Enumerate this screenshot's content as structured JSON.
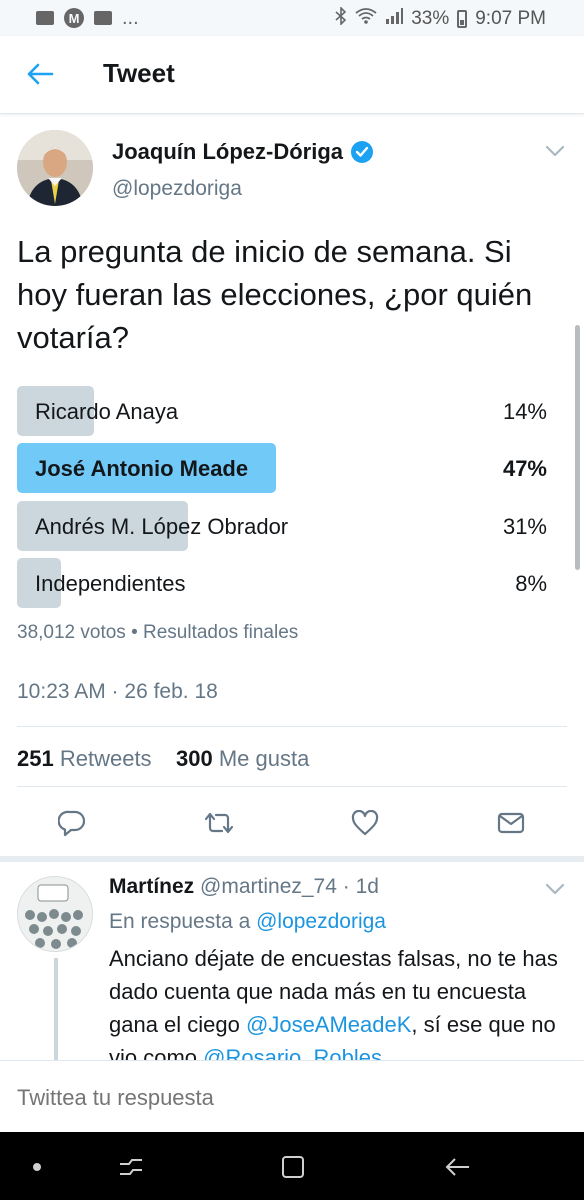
{
  "status_bar": {
    "notification_icons": [
      "mail-icon",
      "m-app-icon",
      "chat-icon"
    ],
    "m_letter": "M",
    "more": "...",
    "battery": "33%",
    "time": "9:07 PM"
  },
  "app_bar": {
    "title": "Tweet"
  },
  "tweet": {
    "author_name": "Joaquín López-Dóriga",
    "handle": "@lopezdoriga",
    "text": "La pregunta de inicio de semana. Si hoy fueran las elecciones, ¿por quién votaría?",
    "poll": {
      "options": [
        {
          "label": "Ricardo Anaya",
          "percent": "14%",
          "fraction": 0.14,
          "winner": false
        },
        {
          "label": "José Antonio Meade",
          "percent": "47%",
          "fraction": 0.47,
          "winner": true
        },
        {
          "label": "Andrés M. López Obrador",
          "percent": "31%",
          "fraction": 0.31,
          "winner": false
        },
        {
          "label": "Independientes",
          "percent": "8%",
          "fraction": 0.08,
          "winner": false
        }
      ],
      "meta": "38,012 votos • Resultados finales"
    },
    "timestamp": "10:23 AM · 26 feb. 18",
    "retweets_count": "251",
    "retweets_label": "Retweets",
    "likes_count": "300",
    "likes_label": "Me gusta"
  },
  "reply": {
    "author_name": "Martínez",
    "handle_time": "@martinez_74 · 1d",
    "reply_to_prefix": "En respuesta a ",
    "reply_to_handle": "@lopezdoriga",
    "text_1": "Anciano déjate de encuestas falsas, no te has dado cuenta que nada más en tu encuesta gana el ciego ",
    "mention_1": "@JoseAMeadeK",
    "text_2": ", sí ese que no vio como ",
    "mention_2": "@Rosario_Robles"
  },
  "composer": {
    "placeholder": "Twittea tu respuesta"
  },
  "colors": {
    "accent": "#1da1f2",
    "link": "#1b95e0",
    "winner_bar": "#71c9f8",
    "bar": "#ccd6dd"
  }
}
